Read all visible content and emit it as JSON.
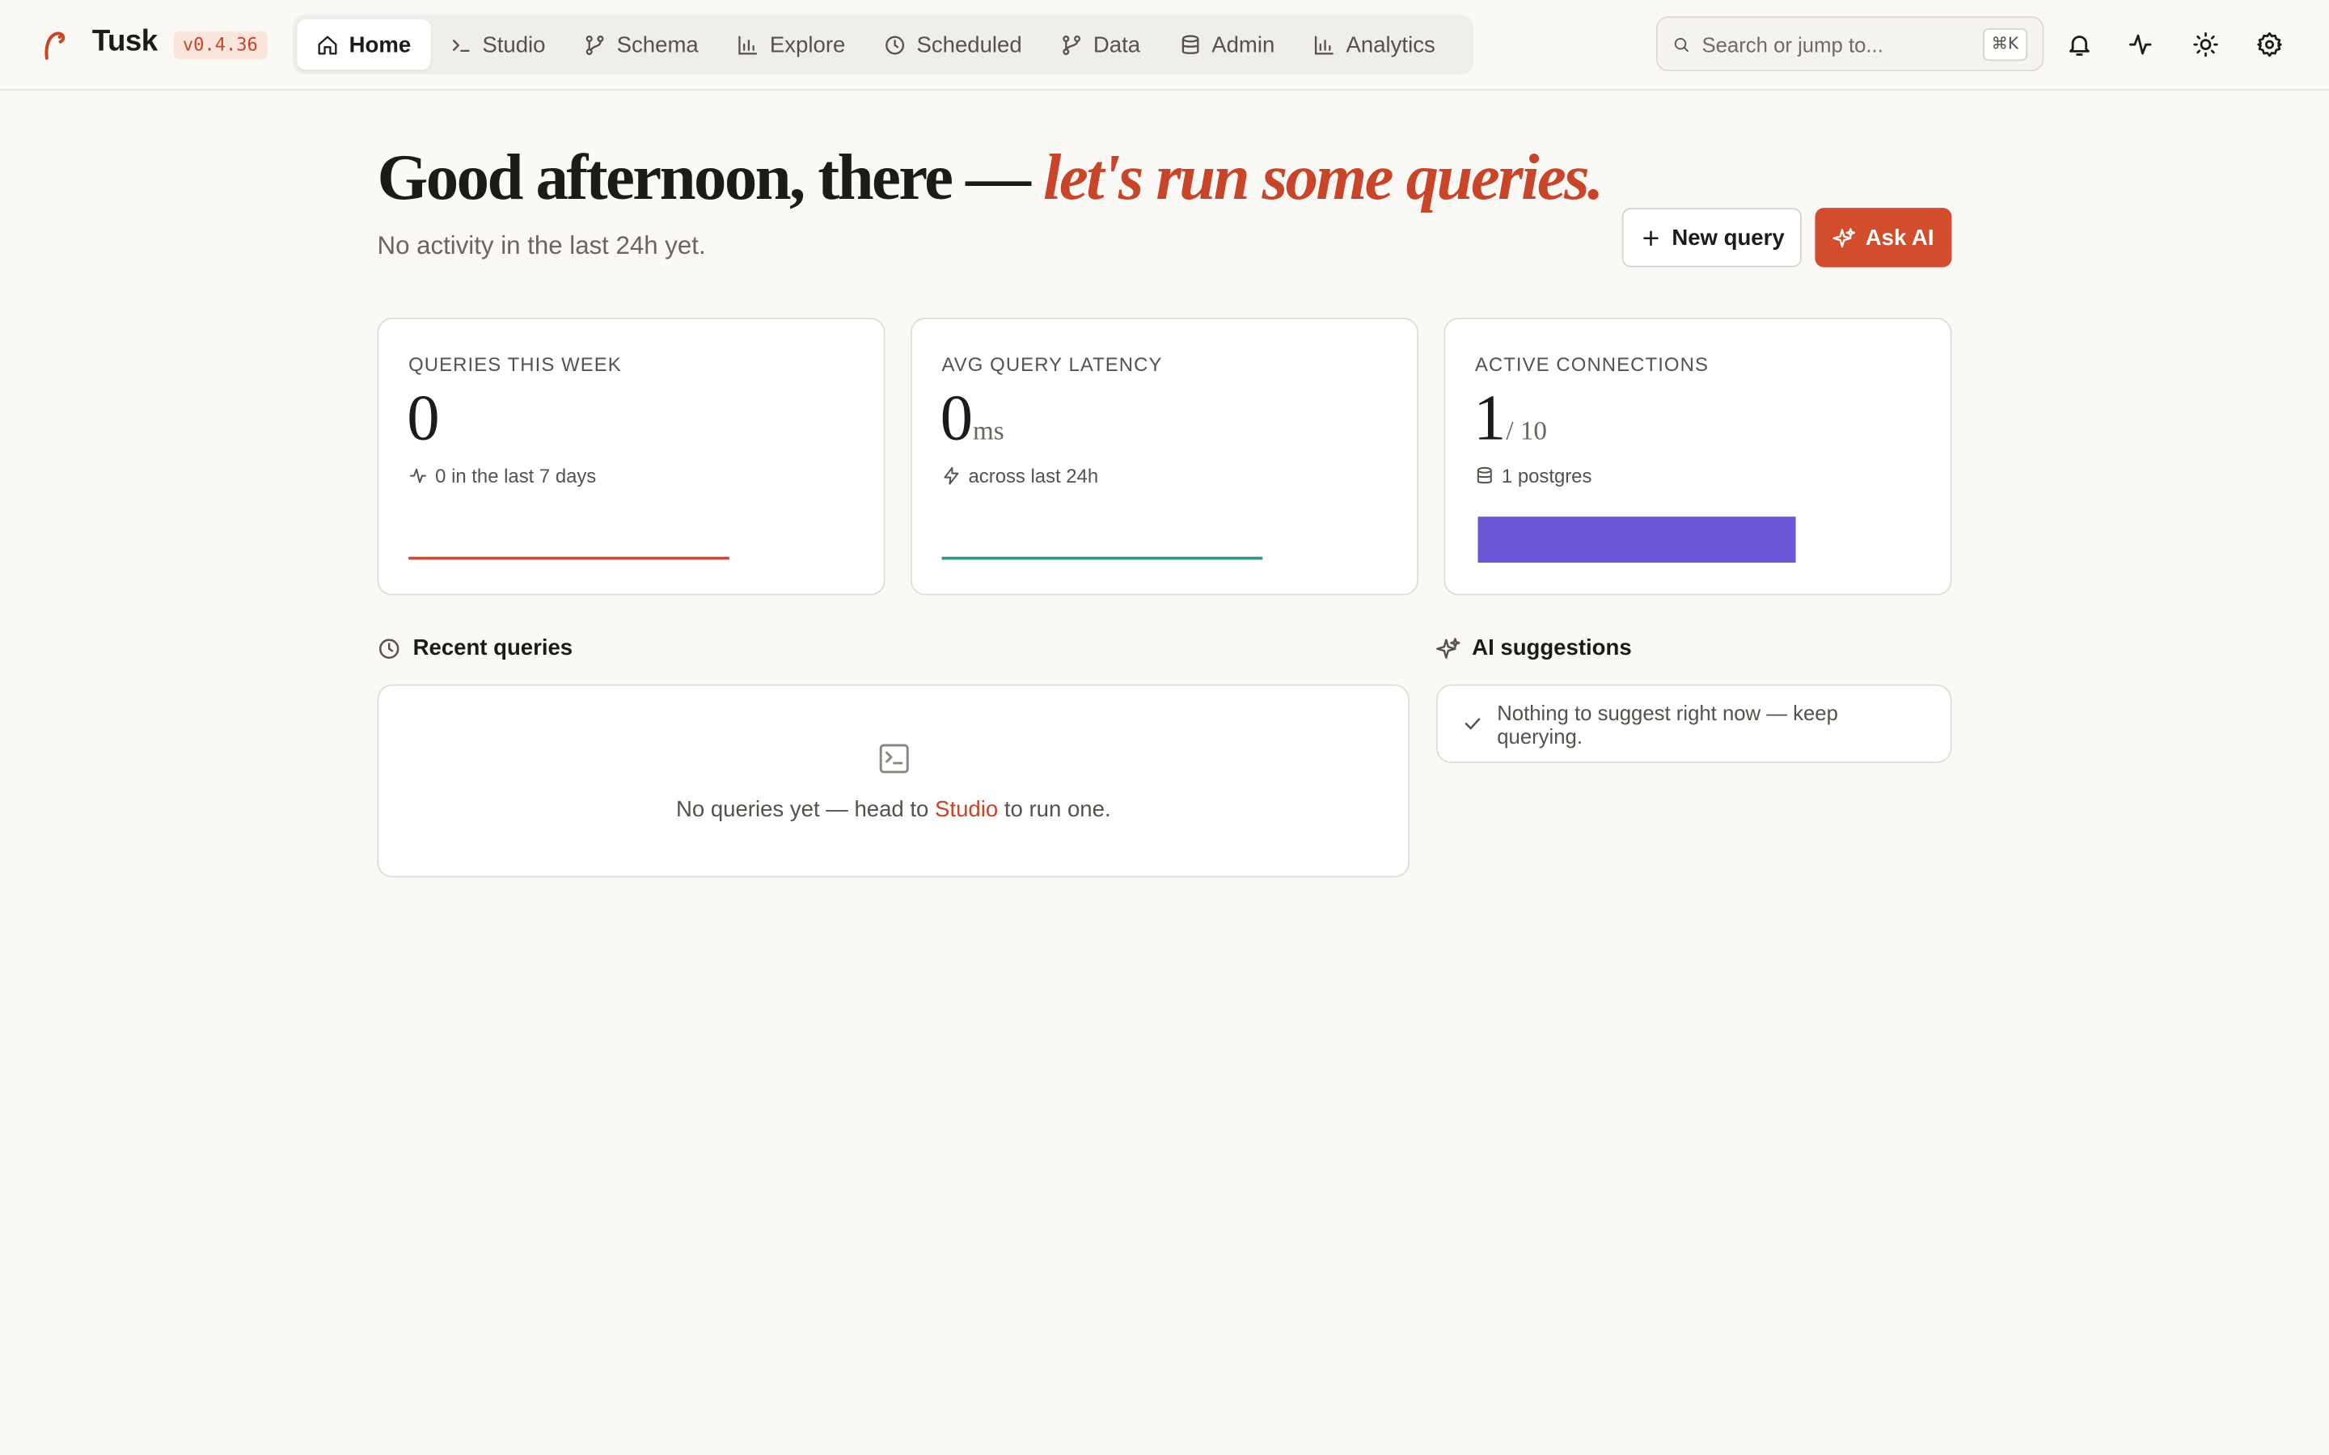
{
  "app": {
    "name": "Tusk",
    "version": "v0.4.36"
  },
  "nav": [
    {
      "label": "Home",
      "icon": "home-icon",
      "active": true
    },
    {
      "label": "Studio",
      "icon": "terminal-icon",
      "active": false
    },
    {
      "label": "Schema",
      "icon": "schema-icon",
      "active": false
    },
    {
      "label": "Explore",
      "icon": "bar-chart-icon",
      "active": false
    },
    {
      "label": "Scheduled",
      "icon": "clock-icon",
      "active": false
    },
    {
      "label": "Data",
      "icon": "git-branch-icon",
      "active": false
    },
    {
      "label": "Admin",
      "icon": "database-icon",
      "active": false
    },
    {
      "label": "Analytics",
      "icon": "bar-chart-icon",
      "active": false
    }
  ],
  "search": {
    "placeholder": "Search or jump to...",
    "shortcut": "⌘K"
  },
  "top_actions": [
    "bell-icon",
    "activity-icon",
    "sun-icon",
    "gear-icon"
  ],
  "hero": {
    "greeting": "Good afternoon, there —",
    "accent": "let's run some queries.",
    "subtitle": "No activity in the last 24h yet."
  },
  "actions": {
    "new_query": "New query",
    "ask_ai": "Ask AI"
  },
  "stats": {
    "queries": {
      "label": "QUERIES THIS WEEK",
      "value": "0",
      "meta": "0 in the last 7 days",
      "color": "#d9472b"
    },
    "latency": {
      "label": "AVG QUERY LATENCY",
      "value": "0",
      "unit": "ms",
      "meta": "across last 24h",
      "color": "#2a9b86"
    },
    "connections": {
      "label": "ACTIVE CONNECTIONS",
      "value": "1",
      "unit": "/ 10",
      "meta": "1 postgres",
      "color": "#6a56d6"
    }
  },
  "recent": {
    "title": "Recent queries",
    "empty_before": "No queries yet — head to",
    "empty_link": "Studio",
    "empty_after": "to run one."
  },
  "ai": {
    "title": "AI suggestions",
    "message": "Nothing to suggest right now — keep querying."
  },
  "colors": {
    "accent": "#c9452a",
    "background": "#faf9f6"
  }
}
